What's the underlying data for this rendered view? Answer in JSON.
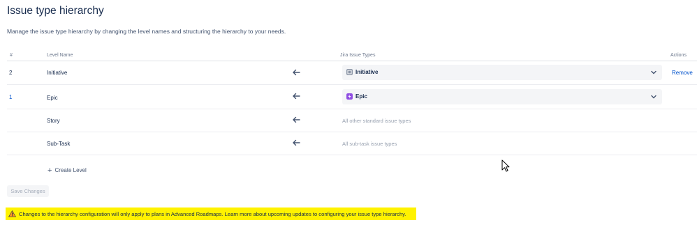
{
  "page": {
    "title": "Issue type hierarchy",
    "description": "Manage the issue type hierarchy by changing the level names and structuring the hierarchy to your needs."
  },
  "table": {
    "headers": {
      "num": "#",
      "level": "Level Name",
      "jira": "Jira Issue Types",
      "actions": "Actions"
    },
    "rows": [
      {
        "num": "2",
        "level": "Initiative",
        "issue_type": "Initiative",
        "issue_icon_color": "#8993a4",
        "action": "Remove"
      },
      {
        "num": "1",
        "level": "Epic",
        "issue_type": "Epic",
        "issue_icon_color": "#904ee2",
        "action": ""
      },
      {
        "num": "",
        "level": "Story",
        "issue_type": "All other standard issue types",
        "action": ""
      },
      {
        "num": "",
        "level": "Sub-Task",
        "issue_type": "All sub-task issue types",
        "action": ""
      }
    ]
  },
  "create_level": {
    "icon": "plus-icon",
    "label": "Create Level"
  },
  "save_button": "Save Changes",
  "banner": {
    "icon": "warning-icon",
    "text": "Changes to the hierarchy configuration will only apply to plans in Advanced Roadmaps. Learn more about upcoming updates to configuring your issue type hierarchy.",
    "color": "#fff200"
  }
}
